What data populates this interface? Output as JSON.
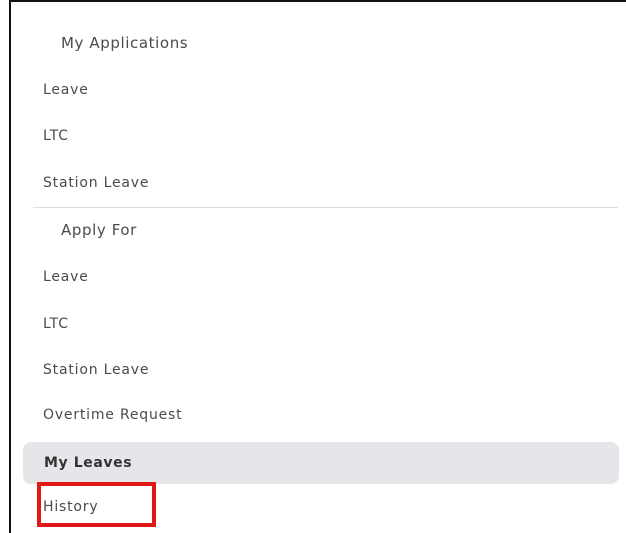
{
  "menu": {
    "my_applications": {
      "title": "My Applications",
      "items": [
        {
          "label": "Leave"
        },
        {
          "label": "LTC"
        },
        {
          "label": "Station Leave"
        }
      ]
    },
    "apply_for": {
      "title": "Apply For",
      "items": [
        {
          "label": "Leave"
        },
        {
          "label": "LTC"
        },
        {
          "label": "Station Leave"
        },
        {
          "label": "Overtime Request"
        }
      ]
    },
    "my_leaves": {
      "label": "My Leaves"
    },
    "history": {
      "label": "History"
    }
  },
  "colors": {
    "text": "#4b4b4b",
    "active_bg": "#e4e6ea",
    "highlight": "#e01818",
    "divider": "#dddddd"
  }
}
